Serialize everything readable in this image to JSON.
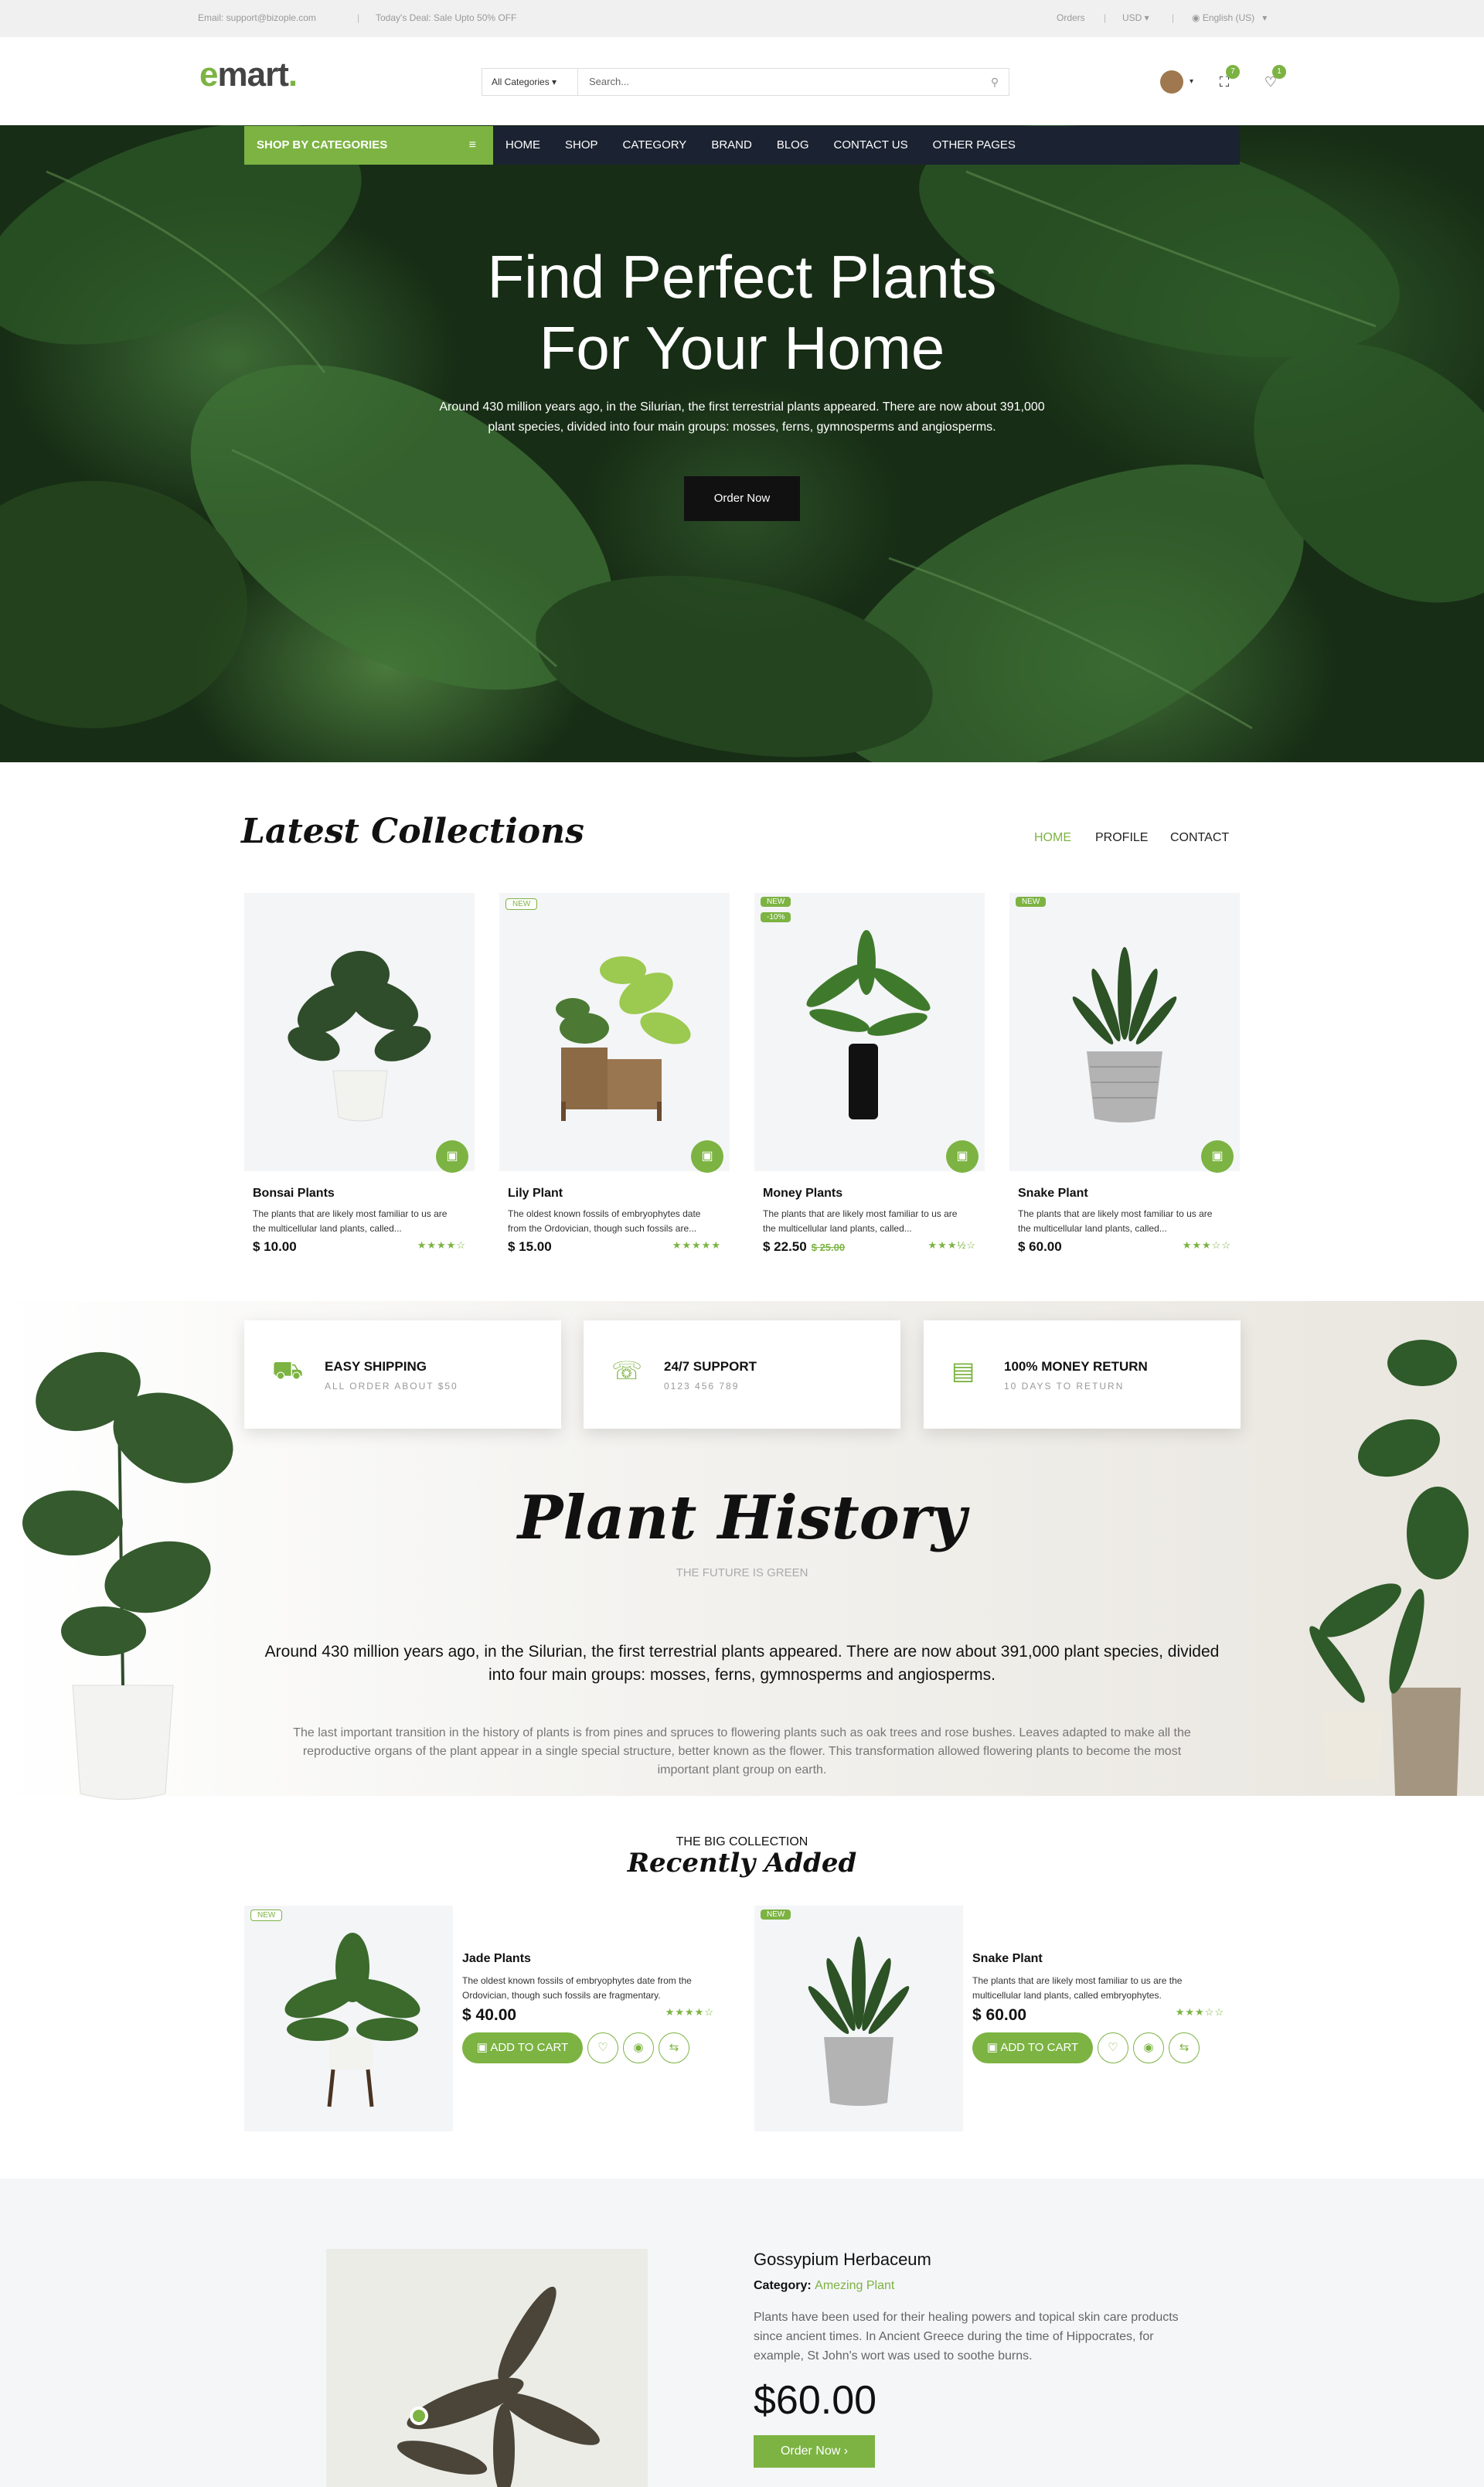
{
  "topbar": {
    "email": "Email:  support@bizople.com",
    "deal": "Today's Deal: Sale Upto 50% OFF",
    "orders": "Orders",
    "currency": "USD",
    "language": "English (US)"
  },
  "header": {
    "logo_e": "e",
    "logo_rest": "mart",
    "logo_dot": ".",
    "category_select": "All Categories",
    "search_placeholder": "Search...",
    "cart_count": "7",
    "wishlist_count": "1"
  },
  "nav": {
    "categories_label": "SHOP BY CATEGORIES",
    "links": [
      "HOME",
      "SHOP",
      "CATEGORY",
      "BRAND",
      "BLOG",
      "CONTACT US",
      "OTHER PAGES"
    ]
  },
  "hero": {
    "title_line1": "Find Perfect Plants",
    "title_line2": "For Your Home",
    "text_line1": "Around 430 million years ago, in the Silurian, the first terrestrial plants appeared. There are now about 391,000",
    "text_line2": "plant species, divided into four main groups: mosses, ferns, gymnosperms and angiosperms.",
    "button": "Order Now"
  },
  "latest": {
    "title": "Latest Collections",
    "tabs": [
      "HOME",
      "PROFILE",
      "CONTACT"
    ],
    "active_tab": "HOME",
    "products": [
      {
        "name": "Bonsai Plants",
        "desc1": "The plants that are likely most familiar to us are",
        "desc2": "the multicellular land plants, called...",
        "price": "$ 10.00",
        "old_price": "",
        "labels": [],
        "stars": "★★★★☆"
      },
      {
        "name": "Lily Plant",
        "desc1": "The oldest known fossils of embryophytes date",
        "desc2": "from the Ordovician, though such fossils are...",
        "price": "$ 15.00",
        "old_price": "",
        "labels": [
          "NEW"
        ],
        "stars": "★★★★★"
      },
      {
        "name": "Money Plants",
        "desc1": "The plants that are likely most familiar to us are",
        "desc2": "the multicellular land plants, called...",
        "price": "$ 22.50",
        "old_price": "$ 25.00",
        "labels": [
          "NEW",
          "-10%"
        ],
        "stars": "★★★½☆"
      },
      {
        "name": "Snake Plant",
        "desc1": "The plants that are likely most familiar to us are",
        "desc2": "the multicellular land plants, called...",
        "price": "$ 60.00",
        "old_price": "",
        "labels": [
          "NEW"
        ],
        "stars": "★★★☆☆"
      }
    ]
  },
  "features": [
    {
      "title": "EASY SHIPPING",
      "sub": "ALL ORDER ABOUT $50",
      "icon": "truck-icon"
    },
    {
      "title": "24/7 SUPPORT",
      "sub": "0123 456 789",
      "icon": "support-icon"
    },
    {
      "title": "100% MONEY RETURN",
      "sub": "10 DAYS TO RETURN",
      "icon": "money-icon"
    }
  ],
  "history": {
    "title": "Plant History",
    "subtitle": "THE FUTURE IS GREEN",
    "main_line1": "Around 430 million years ago, in the Silurian, the first terrestrial plants appeared. There are now about 391,000 plant species, divided",
    "main_line2": "into four main groups: mosses, ferns, gymnosperms and angiosperms.",
    "small_line1": "The last important transition in the history of plants is from pines and spruces to flowering plants such as oak trees and rose bushes. Leaves adapted to make all the",
    "small_line2": "reproductive organs of the plant appear in a single special structure, better known as the flower. This transformation allowed flowering plants to become the most",
    "small_line3": "important plant group on earth."
  },
  "recent": {
    "kicker": "THE BIG COLLECTION",
    "title": "Recently Added",
    "items": [
      {
        "name": "Jade Plants",
        "desc1": "The oldest known fossils of embryophytes date from the",
        "desc2": "Ordovician, though such fossils are fragmentary.",
        "price": "$ 40.00",
        "label": "NEW",
        "stars": "★★★★☆",
        "cart": "ADD TO CART"
      },
      {
        "name": "Snake Plant",
        "desc1": "The plants that are likely most familiar to us are the",
        "desc2": "multicellular land plants, called embryophytes.",
        "price": "$ 60.00",
        "label": "NEW",
        "stars": "★★★☆☆",
        "cart": "ADD TO CART"
      }
    ]
  },
  "featured": {
    "name": "Gossypium Herbaceum",
    "category_label": "Category:",
    "category": "Amezing Plant",
    "desc1": "Plants have been used for their healing powers and topical skin care products",
    "desc2": "since ancient times. In Ancient Greece during the time of Hippocrates, for",
    "desc3": "example, St John's wort was used to soothe burns.",
    "price": "$60.00",
    "button": "Order Now ›"
  }
}
